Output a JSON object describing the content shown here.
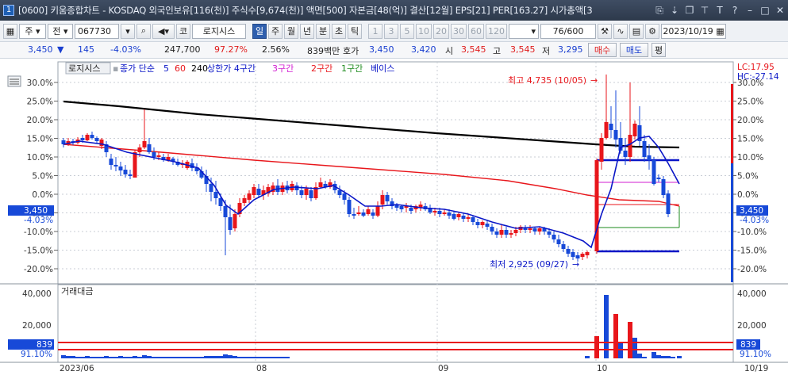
{
  "window": {
    "number": "1",
    "title": "[0600] 키움종합차트 - KOSDAQ 외국인보유[116(천)] 주식수[9,674(천)] 액면[500] 자본금[48(억)] 결산[12월] EPS[21] PER[163.27] 시가총액[3"
  },
  "toolbar": {
    "type_label": "주",
    "type2_label": "전",
    "code": "067730",
    "market_label": "코",
    "stock_name": "로지시스",
    "periods": [
      "일",
      "주",
      "월",
      "년",
      "분",
      "초",
      "틱"
    ],
    "active_period": "일",
    "intervals": [
      "1",
      "3",
      "5",
      "10",
      "20",
      "30",
      "60",
      "120"
    ],
    "count": "76",
    "count_max": "/600",
    "date": "2023/10/19"
  },
  "quote": {
    "price": "3,450",
    "change": "145",
    "change_pct": "-4.03%",
    "volume": "247,700",
    "vol_ratio": "97.27%",
    "turnover": "2.56%",
    "amount": "839백만",
    "hoga_label": "호가",
    "ask": "3,450",
    "bid": "3,420",
    "open_label": "시",
    "open": "3,545",
    "high_label": "고",
    "high": "3,545",
    "low_label": "저",
    "low": "3,295",
    "buy_label": "매수",
    "sell_label": "매도",
    "balance_label": "평"
  },
  "legend": {
    "name": "로지시스",
    "ma_label": "종가 단순",
    "ma5": "5",
    "ma60": "60",
    "ma240": "240",
    "upper": "상한가 4구간",
    "zone3": "3구간",
    "zone2": "2구간",
    "zone1": "1구간",
    "base": "베이스"
  },
  "annotations": {
    "high": "최고 4,735 (10/05)",
    "low": "최저 2,925 (09/27)",
    "lc": "LC:17.95",
    "hc": "HC:-27.14",
    "price_left": "3,450",
    "pct_left": "-4.03%",
    "price_right": "3,450",
    "pct_right": "-4.03%"
  },
  "price_axis": [
    "30.0%",
    "25.0%",
    "20.0%",
    "15.0%",
    "10.0%",
    "5.0%",
    "0.0%",
    "-5.0%",
    "-10.0%",
    "-15.0%",
    "-20.0%"
  ],
  "volume_panel": {
    "title": "거래대금",
    "axis": [
      "40,000",
      "20,000"
    ],
    "value_box": "839",
    "pct": "91.10%"
  },
  "date_axis": [
    "2023/06",
    "08",
    "09",
    "10",
    "10/19"
  ],
  "colors": {
    "up": "#e8161b",
    "down": "#1749d8",
    "ma5": "#0a16c7",
    "ma60": "#e8161b",
    "ma240": "#000000",
    "zone3": "#d21ed2",
    "zone1": "#1b8a1b",
    "base": "#0a16c7"
  }
}
